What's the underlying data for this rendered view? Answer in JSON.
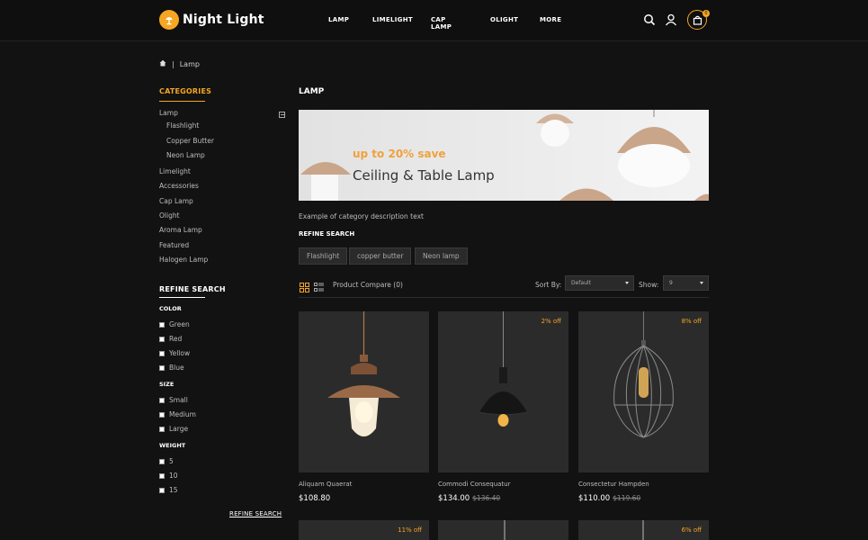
{
  "brand": {
    "name": "Night Light"
  },
  "nav": [
    "LAMP",
    "LIMELIGHT",
    "CAP LAMP",
    "OLIGHT",
    "MORE"
  ],
  "header": {
    "cart_count": "0",
    "icons": [
      "search-icon",
      "user-icon",
      "cart-icon"
    ]
  },
  "breadcrumb": {
    "current": "Lamp"
  },
  "sidebar": {
    "categories_title": "CATEGORIES",
    "categories": [
      "Lamp",
      "Flashlight",
      "Copper Butter",
      "Neon Lamp",
      "Limelight",
      "Accessories",
      "Cap Lamp",
      "Olight",
      "Aroma Lamp",
      "Featured",
      "Halogen Lamp"
    ],
    "refine_title": "REFINE SEARCH",
    "color_label": "COLOR",
    "colors": [
      "Green",
      "Red",
      "Yellow",
      "Blue"
    ],
    "size_label": "SIZE",
    "sizes": [
      "Small",
      "Medium",
      "Large"
    ],
    "weight_label": "WEIGHT",
    "weights": [
      "5",
      "10",
      "15"
    ],
    "refine_link": "REFINE SEARCH"
  },
  "main": {
    "title": "LAMP",
    "banner": {
      "subtitle": "up to 20% save",
      "title": "Ceiling & Table Lamp"
    },
    "description": "Example of category description text",
    "refine_title": "REFINE SEARCH",
    "tags": [
      "Flashlight",
      "copper butter",
      "Neon lamp"
    ],
    "compare_label": "Product Compare (0)",
    "sort_label": "Sort By:",
    "sort_value": "Default",
    "show_label": "Show:",
    "show_value": "9"
  },
  "products": [
    {
      "name": "Aliquam Quaerat",
      "price": "$108.80",
      "old_price": "",
      "discount": ""
    },
    {
      "name": "Commodi Consequatur",
      "price": "$134.00",
      "old_price": "$136.40",
      "discount": "2% off"
    },
    {
      "name": "Consectetur Hampden",
      "price": "$110.00",
      "old_price": "$119.60",
      "discount": "8% off"
    }
  ],
  "products_row2_discounts": [
    "11% off",
    "",
    "6% off"
  ],
  "colors": {
    "accent": "#f5a623",
    "background": "#121212",
    "card": "#2b2b2b"
  }
}
